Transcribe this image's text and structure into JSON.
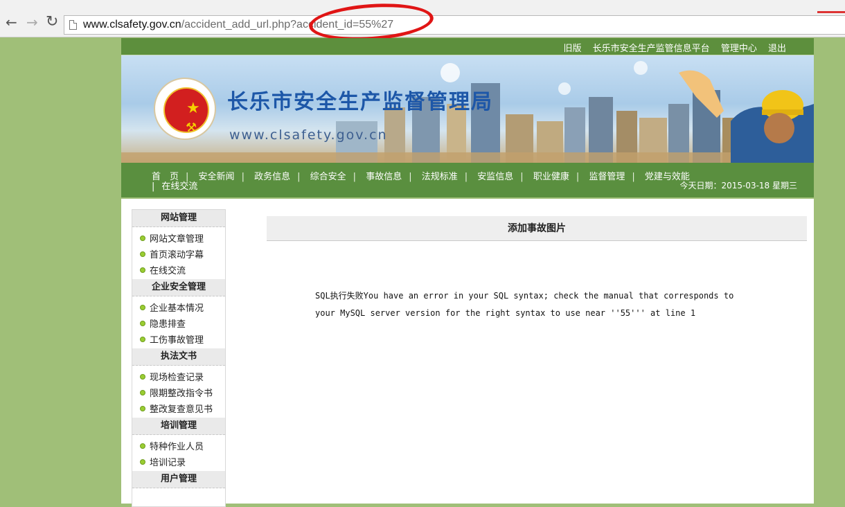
{
  "browser": {
    "url_host": "www.clsafety.gov.cn",
    "url_path": "/accident_add_url.php?accident_id=55%27"
  },
  "top_links": [
    "旧版",
    "长乐市安全生产监管信息平台",
    "管理中心",
    "退出"
  ],
  "banner": {
    "org_name": "长乐市安全生产监督管理局",
    "domain": "www.clsafety.gov.cn"
  },
  "nav": {
    "items": [
      "首　页",
      "安全新闻",
      "政务信息",
      "综合安全",
      "事故信息",
      "法规标准",
      "安监信息",
      "职业健康",
      "监督管理",
      "党建与效能"
    ],
    "second_row": "在线交流",
    "date": "今天日期：2015-03-18 星期三"
  },
  "sidebar": {
    "sections": [
      {
        "title": "网站管理",
        "items": [
          "网站文章管理",
          "首页滚动字幕",
          "在线交流"
        ]
      },
      {
        "title": "企业安全管理",
        "items": [
          "企业基本情况",
          "隐患排查",
          "工伤事故管理"
        ]
      },
      {
        "title": "执法文书",
        "items": [
          "现场检查记录",
          "限期整改指令书",
          "整改复查意见书"
        ]
      },
      {
        "title": "培训管理",
        "items": [
          "特种作业人员",
          "培训记录"
        ]
      },
      {
        "title": "用户管理",
        "items": []
      }
    ]
  },
  "main": {
    "title": "添加事故图片",
    "error_line1": "SQL执行失败You have an error in your SQL syntax; check the manual that corresponds to",
    "error_line2": "your MySQL server version for the right syntax to use near ''55''' at line 1"
  }
}
